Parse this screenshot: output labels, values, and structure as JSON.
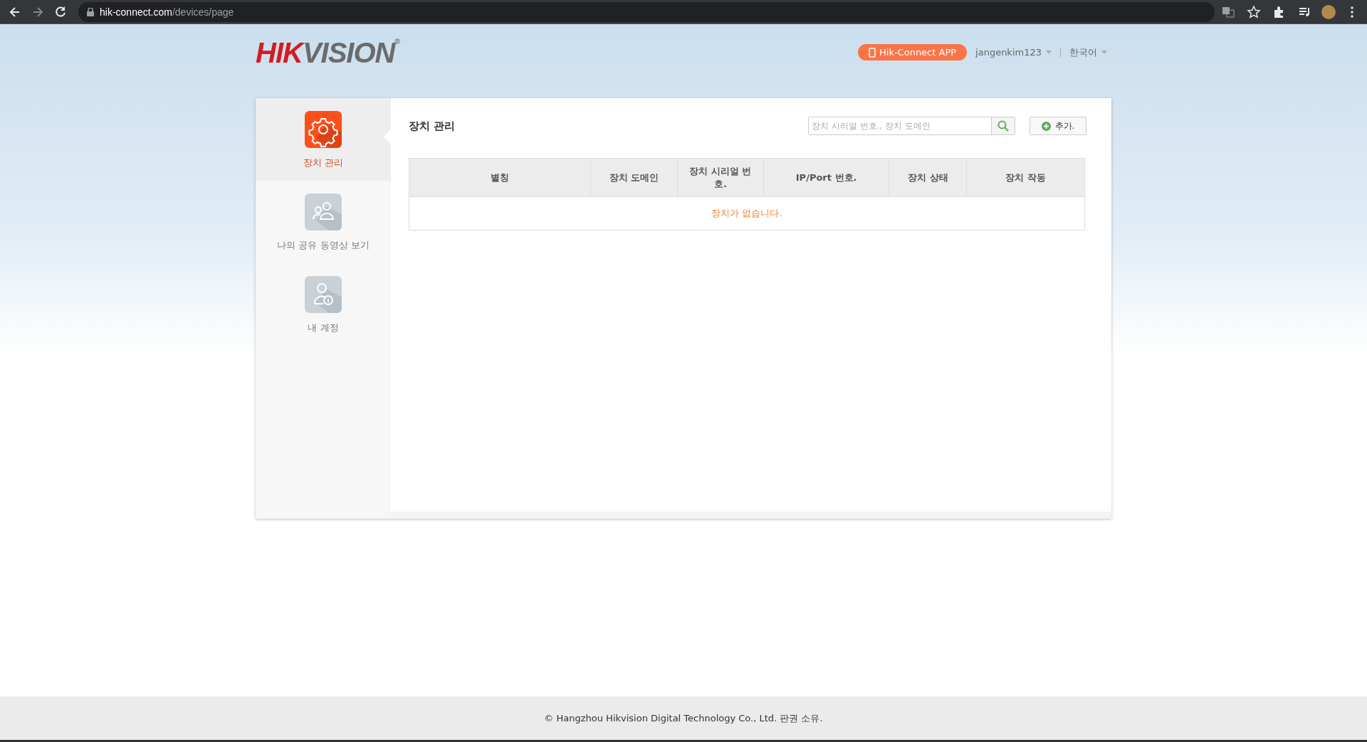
{
  "browser": {
    "url_host": "hik-connect.com",
    "url_path": "/devices/page"
  },
  "header": {
    "logo": {
      "part_1": "HIK",
      "part_2": "VISION",
      "mark": "®"
    },
    "app_button": "Hik-Connect APP",
    "user_menu": "jangenkim123",
    "language_menu": "한국어"
  },
  "sidebar": {
    "items": [
      {
        "label": "장치 관리",
        "kind": "gear",
        "selected": true
      },
      {
        "label": "나의 공유 동영상 보기",
        "kind": "users",
        "selected": false
      },
      {
        "label": "내 계정",
        "kind": "account",
        "selected": false
      }
    ]
  },
  "panel": {
    "title": "장치 관리",
    "search": {
      "placeholder": "장치 시리얼 번호., 장치 도메인"
    },
    "add_button": "추가.",
    "table": {
      "columns": [
        "별칭",
        "장치 도메인",
        "장치 시리얼 번호.",
        "IP/Port 번호.",
        "장치 상태",
        "장치 작동"
      ],
      "empty_message": "장치가 없습니다."
    }
  },
  "footer": {
    "copyright": "© Hangzhou Hikvision Digital Technology Co., Ltd. 판권 소유."
  }
}
